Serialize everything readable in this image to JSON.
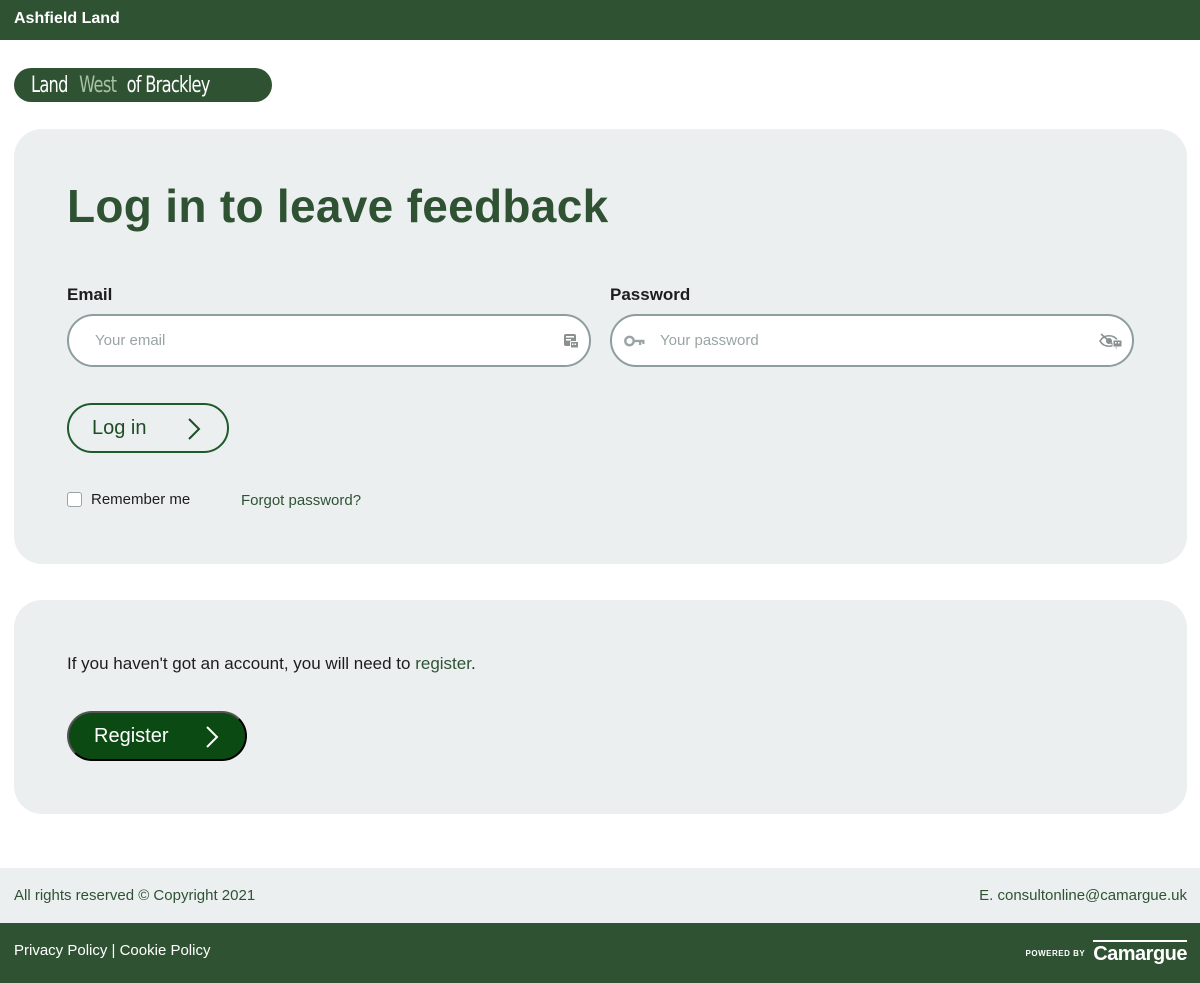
{
  "topbar": {
    "brand": "Ashfield Land"
  },
  "logo": {
    "part1": "Land ",
    "part2": "West",
    "part3": " of Brackley"
  },
  "login": {
    "title": "Log in to leave feedback",
    "email_label": "Email",
    "email_placeholder": "Your email",
    "email_value": "",
    "password_label": "Password",
    "password_placeholder": "Your password",
    "password_value": "",
    "login_button": "Log in",
    "remember_label": "Remember me",
    "remember_checked": false,
    "forgot_link": "Forgot password?"
  },
  "register": {
    "text_before": "If you haven't got an account, you will need to ",
    "link": "register",
    "text_after": ".",
    "button": "Register"
  },
  "footer": {
    "copyright": "All rights reserved © Copyright 2021",
    "email": "E. consultonline@camargue.uk",
    "privacy": "Privacy Policy",
    "separator": " | ",
    "cookie": "Cookie Policy",
    "powered_by": "POWERED BY",
    "powered_brand": "Camargue"
  },
  "colors": {
    "brand_green": "#2f5233",
    "button_green": "#0b4a12",
    "card_bg": "#ebeff0"
  },
  "icons": {
    "email_field": "credential-manager-icon",
    "password_lead": "key-icon",
    "password_trail": "hide-password-icon",
    "button_arrow": "chevron-right-icon"
  }
}
